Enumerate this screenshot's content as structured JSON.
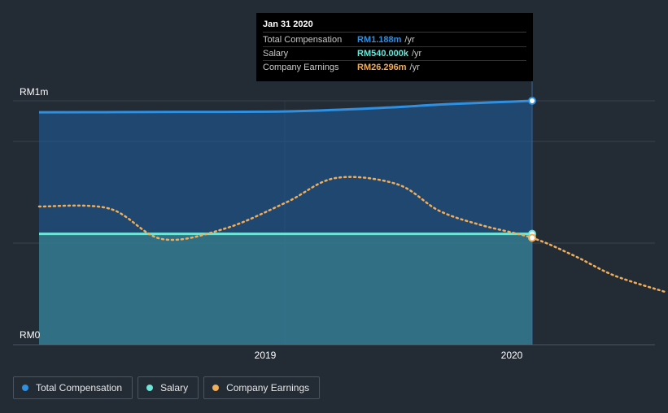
{
  "chart_data": {
    "type": "area",
    "y_axis": {
      "ticks": [
        "RM1m",
        "RM0"
      ],
      "range": [
        0,
        1.188
      ]
    },
    "x_axis": {
      "ticks": [
        "2019",
        "2020"
      ]
    },
    "series": [
      {
        "name": "Total Compensation",
        "color": "#2f8fe0",
        "x": [
          "2018-02-01",
          "2018-06-01",
          "2018-09-01",
          "2019-01-01",
          "2019-04-01",
          "2019-07-01",
          "2019-10-01",
          "2020-01-31"
        ],
        "y": [
          1.132,
          1.133,
          1.134,
          1.135,
          1.142,
          1.155,
          1.172,
          1.188
        ]
      },
      {
        "name": "Salary",
        "color": "#6de5d7",
        "x": [
          "2018-02-01",
          "2020-01-31"
        ],
        "y": [
          0.54,
          0.54
        ]
      },
      {
        "name": "Company Earnings",
        "color": "#f0ad5a",
        "style": "dotted",
        "secondary_axis": true,
        "x": [
          "2018-02-01",
          "2018-05-15",
          "2018-08-01",
          "2018-11-01",
          "2019-02-01",
          "2019-04-15",
          "2019-07-15",
          "2019-09-15",
          "2019-11-15",
          "2020-01-31",
          "2020-04-01",
          "2020-06-01",
          "2020-08-15"
        ],
        "y": [
          34.0,
          33.5,
          26.0,
          28.5,
          35.0,
          41.0,
          39.5,
          33.0,
          29.5,
          26.296,
          22.0,
          17.0,
          13.0
        ]
      }
    ],
    "tooltip": {
      "date": "Jan 31 2020",
      "rows": [
        {
          "label": "Total Compensation",
          "value": "RM1.188m",
          "unit": "/yr",
          "color": "#2f8fe0"
        },
        {
          "label": "Salary",
          "value": "RM540.000k",
          "unit": "/yr",
          "color": "#6de5d7"
        },
        {
          "label": "Company Earnings",
          "value": "RM26.296m",
          "unit": "/yr",
          "color": "#f0ad5a"
        }
      ]
    },
    "grid": true,
    "legend_position": "bottom-left"
  },
  "legend": [
    {
      "label": "Total Compensation",
      "color": "#2f8fe0"
    },
    {
      "label": "Salary",
      "color": "#6de5d7"
    },
    {
      "label": "Company Earnings",
      "color": "#f0ad5a"
    }
  ]
}
